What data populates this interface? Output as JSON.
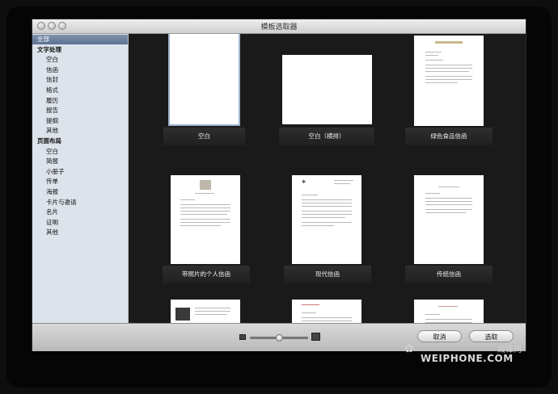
{
  "window": {
    "title": "模板选取器"
  },
  "sidebar": {
    "items": [
      {
        "label": "全部",
        "type": "selected"
      },
      {
        "label": "文字处理",
        "type": "group"
      },
      {
        "label": "空白",
        "type": "item"
      },
      {
        "label": "信函",
        "type": "item"
      },
      {
        "label": "信封",
        "type": "item"
      },
      {
        "label": "格式",
        "type": "item"
      },
      {
        "label": "履历",
        "type": "item"
      },
      {
        "label": "报告",
        "type": "item"
      },
      {
        "label": "提纲",
        "type": "item"
      },
      {
        "label": "其他",
        "type": "item"
      },
      {
        "label": "页面布局",
        "type": "group"
      },
      {
        "label": "空白",
        "type": "item"
      },
      {
        "label": "简报",
        "type": "item"
      },
      {
        "label": "小册子",
        "type": "item"
      },
      {
        "label": "传单",
        "type": "item"
      },
      {
        "label": "海报",
        "type": "item"
      },
      {
        "label": "卡片与邀请",
        "type": "item"
      },
      {
        "label": "名片",
        "type": "item"
      },
      {
        "label": "证明",
        "type": "item"
      },
      {
        "label": "其他",
        "type": "item"
      }
    ]
  },
  "templates": [
    {
      "label": "空白",
      "selected": true
    },
    {
      "label": "空白（横排）",
      "selected": false
    },
    {
      "label": "绿色食品信函",
      "selected": false
    },
    {
      "label": "带照片的个人信函",
      "selected": false
    },
    {
      "label": "现代信函",
      "selected": false
    },
    {
      "label": "传统信函",
      "selected": false
    },
    {
      "label": "",
      "selected": false
    },
    {
      "label": "",
      "selected": false
    },
    {
      "label": "",
      "selected": false
    }
  ],
  "bottom_bar": {
    "cancel_label": "取消",
    "choose_label": "选取",
    "zoom_level": 0.5
  },
  "watermark": {
    "brand": "WEIPHONE.COM",
    "cn": "威锋网"
  }
}
